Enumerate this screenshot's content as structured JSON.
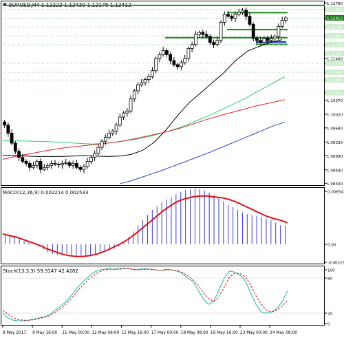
{
  "window": {
    "main_header": "EURUSD,H4  1.12222 1.12439 1.12178 1.12412",
    "macd_header": "MACD(12,26,9) 0.002214 0.002533",
    "stoch_header": "Stoch(13,3,3) 59.3147 42.4282"
  },
  "colors": {
    "candle_up": "#ffffff",
    "candle_down": "#000000",
    "ma_black": "#000000",
    "ma_teal": "#2ecc71",
    "ma_red": "#e02020",
    "ma_blue": "#1f3fd0",
    "level_green": "#1a8a1a",
    "current_price_bg": "#1f7a1f",
    "macd_hist": "#3a3adf",
    "macd_signal": "#e01010",
    "stoch_main": "#20b0a0",
    "stoch_signal": "#e01010"
  },
  "price_axis": {
    "labels": [
      "1.12780",
      "1.12625",
      "1.12405",
      "1.12185",
      "1.11965",
      "1.11745",
      "1.11525",
      "1.11400",
      "1.11285",
      "1.11060",
      "1.10870",
      "1.10555",
      "1.10370",
      "1.10020",
      "1.09680",
      "1.09330",
      "1.08990",
      "1.08640",
      "1.08300"
    ],
    "current_price": "1.12412"
  },
  "macd_axis": {
    "labels": [
      "0.006541",
      "0.00",
      "-0.002232"
    ]
  },
  "stoch_axis": {
    "labels": [
      "100",
      "80",
      "20",
      "0"
    ]
  },
  "time_axis": {
    "labels": [
      "8 May 2017",
      "9 May 16:00",
      "11 May 00:00",
      "12 May 08:00",
      "15 May 16:00",
      "17 May 00:00",
      "18 May 08:00",
      "19 May 16:00",
      "23 May 00:00",
      "24 May 08:00"
    ]
  },
  "chart_data": {
    "type": "candlestick",
    "symbol": "EURUSD",
    "timeframe": "H4",
    "ylim": [
      1.0826,
      1.1282
    ],
    "candles_close": [
      1.0975,
      1.0955,
      1.093,
      1.091,
      1.0895,
      1.0885,
      1.088,
      1.087,
      1.0875,
      1.0885,
      1.0865,
      1.087,
      1.0875,
      1.088,
      1.0878,
      1.0876,
      1.088,
      1.0882,
      1.0875,
      1.088,
      1.087,
      1.0865,
      1.0872,
      1.0885,
      1.0895,
      1.0905,
      1.092,
      1.0935,
      1.0945,
      1.0955,
      1.096,
      1.0975,
      1.0995,
      1.1005,
      1.101,
      1.104,
      1.106,
      1.1075,
      1.108,
      1.1088,
      1.1095,
      1.111,
      1.114,
      1.115,
      1.116,
      1.115,
      1.1135,
      1.1125,
      1.112,
      1.113,
      1.114,
      1.1165,
      1.1175,
      1.12,
      1.1205,
      1.12,
      1.1195,
      1.118,
      1.1175,
      1.1185,
      1.123,
      1.125,
      1.1245,
      1.124,
      1.125,
      1.1255,
      1.126,
      1.1245,
      1.1225,
      1.119,
      1.1185,
      1.118,
      1.119,
      1.1185,
      1.119,
      1.1195,
      1.122,
      1.1235,
      1.1241
    ],
    "levels": [
      1.1272,
      1.1254,
      1.1212,
      1.1192,
      1.1175
    ],
    "sma_black": [
      1.09,
      1.09,
      1.0898,
      1.0897,
      1.0897,
      1.0897,
      1.0898,
      1.0899,
      1.0898,
      1.0897,
      1.0898,
      1.0902,
      1.0912,
      1.0932,
      1.0962,
      1.0998,
      1.103,
      1.1055,
      1.108,
      1.1105,
      1.1135,
      1.1158,
      1.117,
      1.118,
      1.1187
    ],
    "sma_teal": [
      1.0936,
      1.0936,
      1.0935,
      1.0934,
      1.0932,
      1.093,
      1.0928,
      1.093,
      1.0935,
      1.094,
      1.0948,
      1.0958,
      1.097,
      1.0985,
      1.1,
      1.1018,
      1.1035,
      1.1055,
      1.1075,
      1.1095
    ],
    "sma_red": [
      1.089,
      1.0898,
      1.0905,
      1.0912,
      1.0918,
      1.0922,
      1.0926,
      1.093,
      1.0935,
      1.0942,
      1.095,
      1.0958,
      1.0968,
      1.098,
      1.0992,
      1.1002,
      1.1012,
      1.1022,
      1.103,
      1.1038
    ],
    "sma_blue": [
      1.083,
      1.0836,
      1.0844,
      1.0852,
      1.086,
      1.0869,
      1.0878,
      1.0887,
      1.0896,
      1.0905,
      1.0915,
      1.0925,
      1.0935,
      1.0945,
      1.0955,
      1.0965,
      1.0975,
      1.0982
    ],
    "macd_hist": [
      0.001,
      0.0009,
      0.0008,
      0.0006,
      0.0004,
      0.0002,
      0.0,
      -0.0003,
      -0.0006,
      -0.0009,
      -0.0011,
      -0.0012,
      -0.0012,
      -0.0011,
      -0.0012,
      -0.0013,
      -0.0013,
      -0.0014,
      -0.0013,
      -0.0012,
      -0.001,
      -0.0009,
      -0.0007,
      -0.0005,
      -0.0002,
      0.0002,
      0.0008,
      0.0015,
      0.0022,
      0.0028,
      0.0034,
      0.004,
      0.0044,
      0.0048,
      0.0052,
      0.0055,
      0.0058,
      0.0061,
      0.0063,
      0.0064,
      0.0065,
      0.0064,
      0.0062,
      0.006,
      0.0057,
      0.0054,
      0.005,
      0.0046,
      0.0043,
      0.004,
      0.0037,
      0.0035,
      0.0034,
      0.0033,
      0.0032,
      0.003,
      0.0028,
      0.0025,
      0.0022,
      0.0022
    ],
    "macd_signal": [
      0.0012,
      0.001,
      0.0008,
      0.0005,
      0.0002,
      -0.0001,
      -0.0005,
      -0.0008,
      -0.0011,
      -0.0013,
      -0.0014,
      -0.0014,
      -0.0013,
      -0.0011,
      -0.0008,
      -0.0004,
      0.0,
      0.0005,
      0.0011,
      0.0018,
      0.0025,
      0.0032,
      0.0039,
      0.0045,
      0.005,
      0.0053,
      0.0055,
      0.0056,
      0.0056,
      0.0055,
      0.0054,
      0.0052,
      0.0049,
      0.0045,
      0.0041,
      0.0037,
      0.0033,
      0.003,
      0.0028,
      0.0025
    ],
    "stoch_main": [
      20,
      12,
      8,
      7,
      7,
      8,
      10,
      12,
      14,
      18,
      25,
      32,
      40,
      50,
      62,
      72,
      80,
      88,
      93,
      95,
      96,
      95,
      96,
      97,
      96,
      94,
      95,
      96,
      95,
      94,
      93,
      95,
      94,
      92,
      88,
      80,
      75,
      60,
      45,
      35,
      40,
      60,
      80,
      92,
      90,
      85,
      75,
      55,
      35,
      22,
      20,
      22,
      28,
      40,
      59
    ],
    "stoch_signal": [
      25,
      18,
      12,
      9,
      8,
      8,
      9,
      11,
      13,
      16,
      22,
      28,
      36,
      45,
      56,
      66,
      75,
      83,
      89,
      93,
      95,
      95,
      95,
      96,
      96,
      95,
      94,
      95,
      95,
      94,
      93,
      94,
      94,
      93,
      90,
      84,
      78,
      68,
      55,
      45,
      40,
      48,
      65,
      82,
      88,
      88,
      82,
      68,
      50,
      35,
      25,
      22,
      25,
      32,
      42
    ],
    "stoch_levels": [
      80,
      20
    ]
  }
}
